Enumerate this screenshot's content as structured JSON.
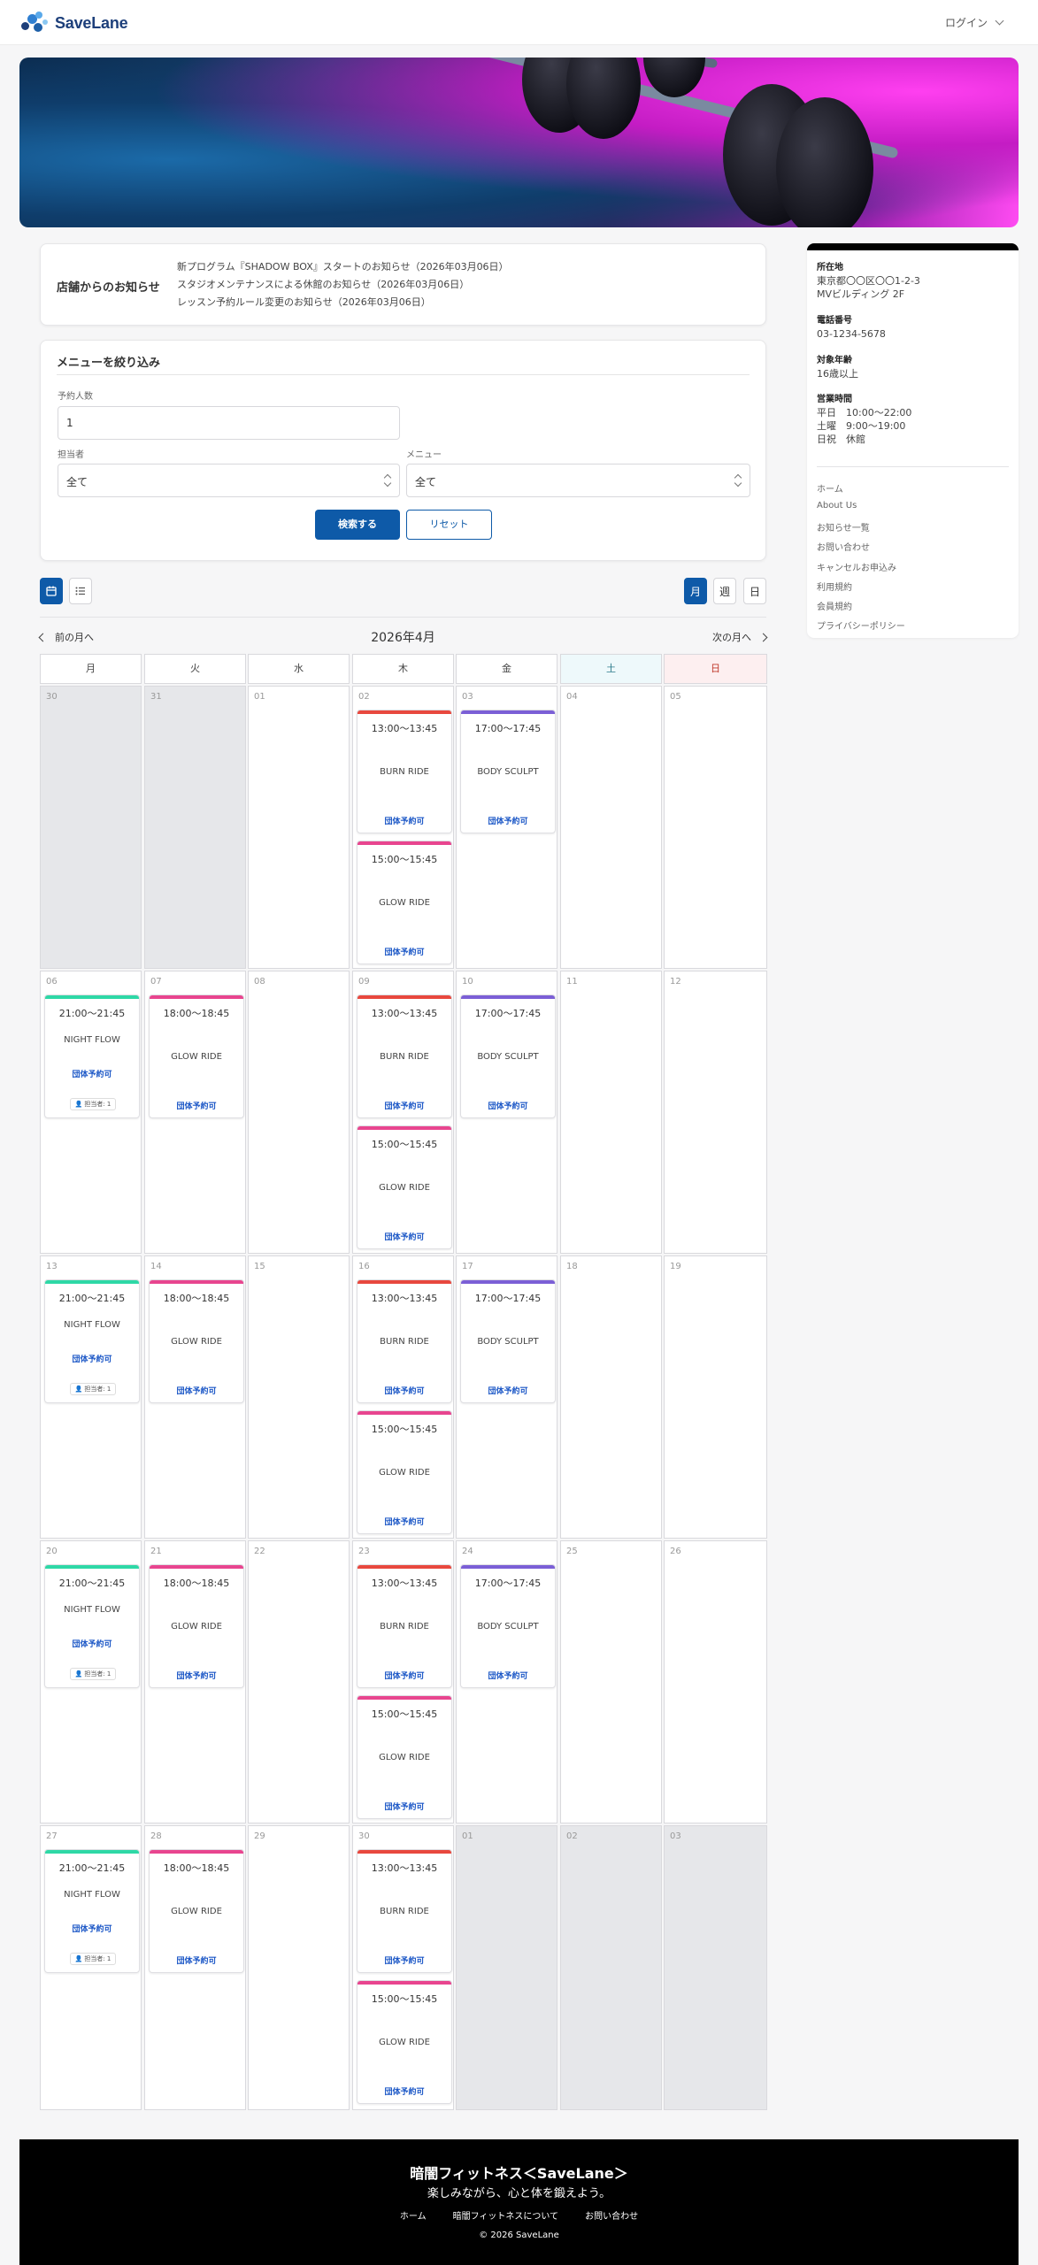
{
  "header": {
    "brand": "SaveLane",
    "login_label": "ログイン"
  },
  "notice": {
    "title": "店舗からのお知らせ",
    "items": [
      "新プログラム『SHADOW BOX』スタートのお知らせ（2026年03月06日）",
      "スタジオメンテナンスによる休館のお知らせ（2026年03月06日）",
      "レッスン予約ルール変更のお知らせ（2026年03月06日）"
    ]
  },
  "filter": {
    "title": "メニューを絞り込み",
    "people_label": "予約人数",
    "people_value": "1",
    "staff_label": "担当者",
    "staff_value": "全て",
    "menu_label": "メニュー",
    "menu_value": "全て",
    "search_label": "検索する",
    "reset_label": "リセット"
  },
  "view": {
    "month_label": "月",
    "week_label": "週",
    "day_label": "日"
  },
  "calendar": {
    "prev_label": "前の月へ",
    "next_label": "次の月へ",
    "title": "2026年4月",
    "weekdays": [
      "月",
      "火",
      "水",
      "木",
      "金",
      "土",
      "日"
    ],
    "weeks": [
      [
        "30",
        "31",
        "01",
        "02",
        "03",
        "04",
        "05"
      ],
      [
        "06",
        "07",
        "08",
        "09",
        "10",
        "11",
        "12"
      ],
      [
        "13",
        "14",
        "15",
        "16",
        "17",
        "18",
        "19"
      ],
      [
        "20",
        "21",
        "22",
        "23",
        "24",
        "25",
        "26"
      ],
      [
        "27",
        "28",
        "29",
        "30",
        "01",
        "02",
        "03"
      ]
    ],
    "event_tag": "団体予約可",
    "staff_chip": "担当者: 1",
    "classes": {
      "night_flow": {
        "time": "21:00〜21:45",
        "name": "NIGHT FLOW",
        "color": "#2ed8a6"
      },
      "glow_ride_tue": {
        "time": "18:00〜18:45",
        "name": "GLOW RIDE",
        "color": "#e8458f"
      },
      "burn_ride": {
        "time": "13:00〜13:45",
        "name": "BURN RIDE",
        "color": "#e8483e"
      },
      "glow_ride_thu": {
        "time": "15:00〜15:45",
        "name": "GLOW RIDE",
        "color": "#e8458f"
      },
      "body_sculpt": {
        "time": "17:00〜17:45",
        "name": "BODY SCULPT",
        "color": "#7b5fd6"
      }
    }
  },
  "sidebar": {
    "address_label": "所在地",
    "address_lines": [
      "東京都〇〇区〇〇1-2-3",
      "MVビルディング 2F"
    ],
    "phone_label": "電話番号",
    "phone": "03-1234-5678",
    "age_label": "対象年齢",
    "age": "16歳以上",
    "hours_label": "営業時間",
    "hours_lines": [
      "平日　10:00〜22:00",
      "土曜　9:00〜19:00",
      "日祝　休館"
    ],
    "links": [
      "ホーム",
      "About Us",
      "お知らせ一覧",
      "お問い合わせ",
      "キャンセルお申込み",
      "利用規約",
      "会員規約",
      "プライバシーポリシー"
    ]
  },
  "footer": {
    "title": "暗闇フィットネス＜SaveLane＞",
    "subtitle": "楽しみながら、心と体を鍛えよう。",
    "links": [
      "ホーム",
      "暗闇フィットネスについて",
      "お問い合わせ"
    ],
    "copyright": "© 2026 SaveLane"
  }
}
